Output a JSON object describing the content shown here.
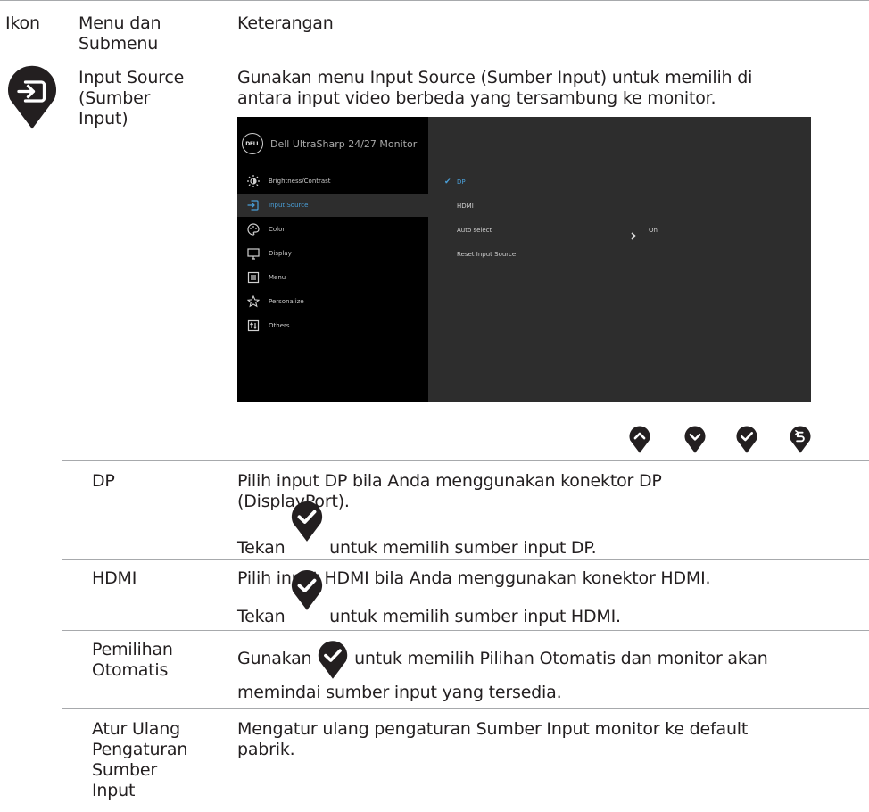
{
  "header": {
    "col_icon": "Ikon",
    "col_menu": "Menu dan Submenu",
    "col_desc": "Keterangan"
  },
  "main": {
    "menu_name": "Input Source (Sumber Input)",
    "description": "Gunakan menu Input Source (Sumber Input) untuk memilih di antara input video berbeda yang tersambung ke monitor."
  },
  "osd": {
    "title": "Dell UltraSharp 24/27 Monitor",
    "logo": "DELL",
    "menu": [
      {
        "label": "Brightness/Contrast",
        "icon": "brightness-icon"
      },
      {
        "label": "Input Source",
        "icon": "input-source-icon"
      },
      {
        "label": "Color",
        "icon": "palette-icon"
      },
      {
        "label": "Display",
        "icon": "display-icon"
      },
      {
        "label": "Menu",
        "icon": "menu-icon"
      },
      {
        "label": "Personalize",
        "icon": "star-icon"
      },
      {
        "label": "Others",
        "icon": "others-icon"
      }
    ],
    "options": [
      {
        "label": "DP",
        "selected": true
      },
      {
        "label": "HDMI"
      },
      {
        "label": "Auto select",
        "value": "On"
      },
      {
        "label": "Reset Input Source"
      }
    ],
    "accent_color": "#4a9fd8"
  },
  "buttons": [
    "up-button-icon",
    "down-button-icon",
    "check-button-icon",
    "back-button-icon"
  ],
  "rows": [
    {
      "name": "DP",
      "line1": "Pilih input DP bila Anda menggunakan konektor DP (DisplayPort).",
      "line2_pre": "Tekan",
      "line2_post": "untuk memilih sumber input DP."
    },
    {
      "name": "HDMI",
      "line1": "Pilih input HDMI bila Anda menggunakan konektor HDMI.",
      "line2_pre": "Tekan",
      "line2_post": "untuk memilih sumber input HDMI."
    },
    {
      "name": "Pemilihan Otomatis",
      "line1_pre": "Gunakan",
      "line1_post": "untuk memilih Pilihan Otomatis dan monitor akan",
      "line2": "memindai sumber input yang tersedia."
    },
    {
      "name": "Atur Ulang Pengaturan Sumber Input",
      "line1": "Mengatur ulang pengaturan Sumber Input monitor ke default pabrik."
    }
  ]
}
